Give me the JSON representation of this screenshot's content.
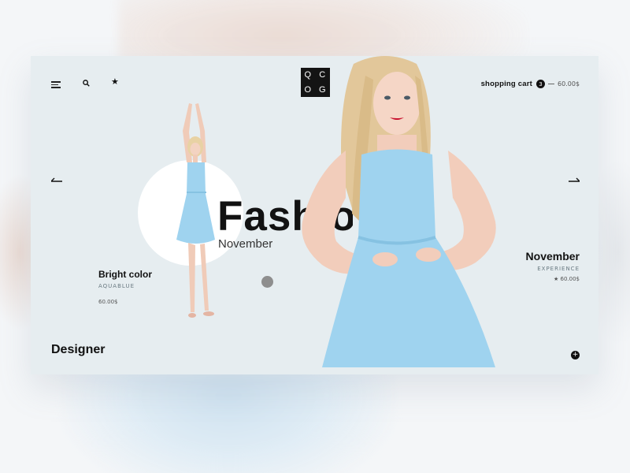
{
  "header": {
    "logo_letters": [
      "Q",
      "C",
      "O",
      "G"
    ],
    "cart": {
      "label": "shopping cart",
      "count": "3",
      "total": "60.00$"
    }
  },
  "hero": {
    "headline": "Fashion",
    "subheadline": "November"
  },
  "product_left": {
    "title": "Bright color",
    "subtitle": "AQUABLUE",
    "price": "60.00$"
  },
  "product_right": {
    "title": "November",
    "subtitle": "EXPERIENCE",
    "price": "60.00$"
  },
  "footer": {
    "designer_label": "Designer"
  },
  "icons": {
    "menu": "menu-icon",
    "search": "search-icon",
    "favorite": "star-icon",
    "prev": "arrow-left-icon",
    "next": "arrow-right-icon",
    "add": "plus-icon"
  },
  "colors": {
    "card_bg": "#e6edf0",
    "dress": "#9fd3ef",
    "logo_bg": "#141414",
    "lipstick": "#c8102e"
  }
}
